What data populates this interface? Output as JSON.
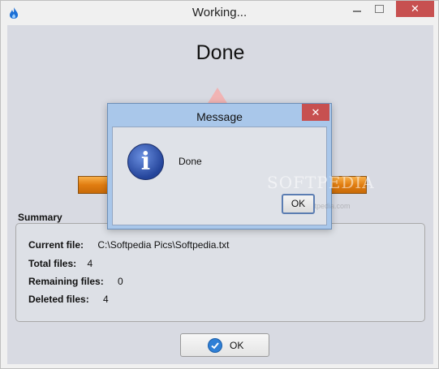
{
  "window": {
    "title": "Working...",
    "icon": "flame-icon",
    "close_glyph": "✕"
  },
  "main": {
    "heading": "Done",
    "progress_value": 1.0,
    "summary": {
      "label": "Summary",
      "rows": [
        {
          "key": "Current file:",
          "value": "C:\\Softpedia Pics\\Softpedia.txt"
        },
        {
          "key": "Total files:",
          "value": "4"
        },
        {
          "key": "Remaining files:",
          "value": "0"
        },
        {
          "key": "Deleted files:",
          "value": "4"
        }
      ]
    },
    "ok_label": "OK"
  },
  "dialog": {
    "title": "Message",
    "close_glyph": "✕",
    "message": "Done",
    "icon": "info-icon",
    "icon_glyph": "i",
    "ok_label": "OK",
    "watermark": "SOFTPEDIA",
    "watermark_url": "www.softpedia.com"
  },
  "colors": {
    "progress": "#e17d10",
    "close_button": "#c75050",
    "dialog_frame": "#a9c7ea",
    "ok_check": "#2e7fd6"
  }
}
